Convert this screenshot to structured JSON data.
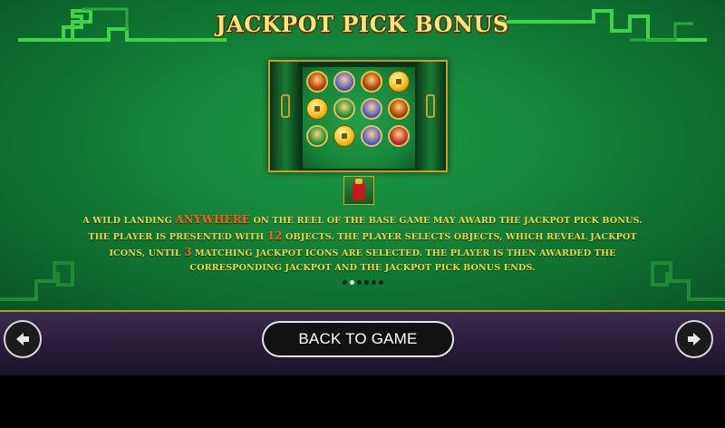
{
  "page": {
    "title": "JACKPOT PICK BONUS"
  },
  "preview": {
    "tokens": [
      "char",
      "blue",
      "char",
      "coin",
      "coin",
      "green",
      "blue",
      "char",
      "green",
      "coin",
      "blue",
      "red"
    ]
  },
  "description": {
    "part1": "A wild landing ",
    "highlight1": "ANYWHERE",
    "part2": " on the reel of the base game may award the Jackpot Pick Bonus. The player is presented with ",
    "highlight2": "12",
    "part3": " objects. The player selects objects, which reveal jackpot icons, until ",
    "highlight3": "3",
    "part4": " matching jackpot icons are selected. The player is then awarded the corresponding jackpot and the Jackpot Pick Bonus ends."
  },
  "pagination": {
    "total": 6,
    "active_index": 1
  },
  "footer": {
    "back_label": "BACK TO GAME",
    "prev_icon": "arrow-left-icon",
    "next_icon": "arrow-right-icon"
  },
  "colors": {
    "background_green": "#15843a",
    "title_gold": "#ffe27a",
    "text_gold": "#f4d24a",
    "highlight_orange": "#ff5a1a",
    "bar_purple": "#2a1d3a",
    "bar_border_gold": "#b8913a"
  }
}
